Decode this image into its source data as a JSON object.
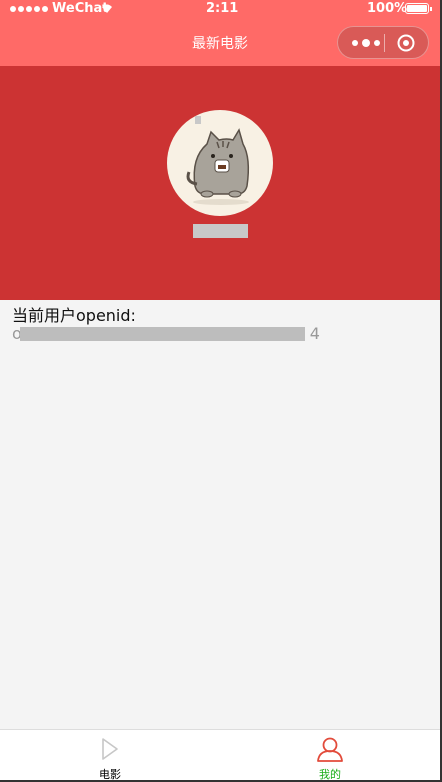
{
  "status_bar": {
    "carrier": "WeChat",
    "time": "2:11",
    "battery": "100%",
    "wifi_icon": "wifi-icon",
    "battery_icon": "battery-icon"
  },
  "nav_bar": {
    "title": "最新电影",
    "more_icon": "more-dots-icon",
    "close_icon": "record-close-icon"
  },
  "profile": {
    "avatar": "pusheen-cat-avatar",
    "nickname": "xxxx"
  },
  "content": {
    "openid_label": "当前用户openid:",
    "openid_value_start": "o",
    "openid_value_end": "4"
  },
  "tab_bar": {
    "items": [
      {
        "label": "电影",
        "icon": "play-icon",
        "active": false
      },
      {
        "label": "我的",
        "icon": "person-icon",
        "active": true
      }
    ]
  },
  "colors": {
    "nav_background": "#ff6a67",
    "header_background": "#cc3333",
    "active_tab": "#1aad19"
  }
}
